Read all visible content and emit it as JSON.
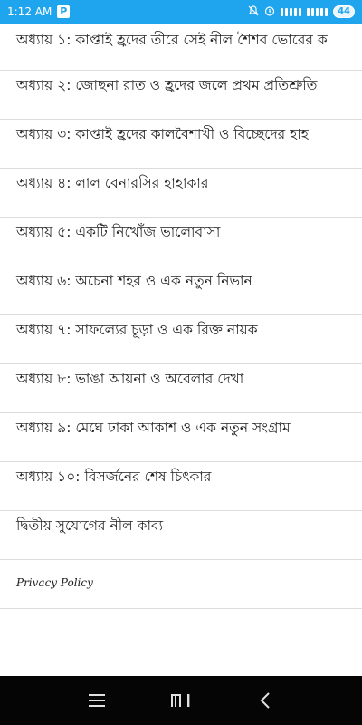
{
  "status": {
    "time": "1:12 AM",
    "battery": "44"
  },
  "chapters": [
    "অধ্যায় ১: কাপ্তাই হ্রদের তীরে সেই নীল শৈশব ভোরের ক",
    "অধ্যায় ২: জোছনা রাত ও হ্রদের জলে প্রথম প্রতিশ্রুতি",
    "অধ্যায় ৩: কাপ্তাই হ্রদের কালবৈশাখী ও বিচ্ছেদের হাহ",
    "অধ্যায় ৪: লাল বেনারসির হাহাকার",
    "অধ্যায় ৫: একটি নিখোঁজ ভালোবাসা",
    "অধ্যায় ৬: অচেনা শহর ও এক নতুন নিভান",
    "অধ্যায় ৭: সাফল্যের চূড়া ও এক রিক্ত নায়ক",
    "অধ্যায় ৮: ভাঙা আয়না ও অবেলার দেখা",
    "অধ্যায় ৯: মেঘে ঢাকা আকাশ ও এক নতুন সংগ্রাম",
    "অধ্যায় ১০: বিসর্জনের শেষ চিৎকার",
    "দ্বিতীয় সুযোগের নীল কাব্য"
  ],
  "privacy": "Privacy Policy",
  "colors": {
    "status_bar": "#1fa4ee",
    "nav_bar": "#050505"
  }
}
